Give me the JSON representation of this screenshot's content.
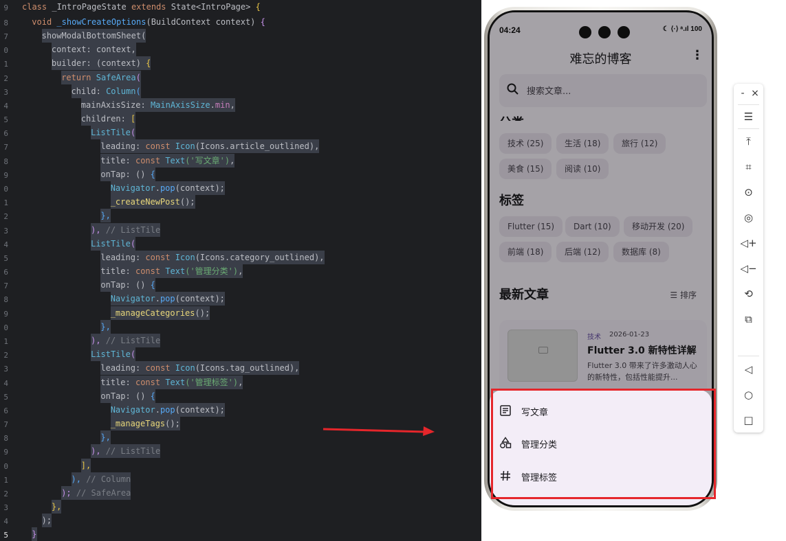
{
  "editor": {
    "line_numbers": [
      "9",
      "8",
      "7",
      "0",
      "1",
      "2",
      "3",
      "4",
      "5",
      "6",
      "7",
      "8",
      "9",
      "0",
      "1",
      "2",
      "3",
      "4",
      "5",
      "6",
      "7",
      "8",
      "9",
      "0",
      "1",
      "2",
      "3",
      "4",
      "5",
      "6",
      "7",
      "8",
      "9",
      "0",
      "1",
      "2",
      "3",
      "4",
      "5"
    ],
    "lines": [
      {
        "indent": 0,
        "tokens": [
          {
            "t": "class ",
            "c": "kw"
          },
          {
            "t": "_IntroPageState ",
            "c": "plain"
          },
          {
            "t": "extends ",
            "c": "kw"
          },
          {
            "t": "State",
            "c": "plain"
          },
          {
            "t": "<IntroPage> ",
            "c": "plain"
          },
          {
            "t": "{",
            "c": "br"
          }
        ]
      },
      {
        "indent": 1,
        "tokens": [
          {
            "t": "void ",
            "c": "kw"
          },
          {
            "t": "_showCreateOptions",
            "c": "fn"
          },
          {
            "t": "(BuildContext context) ",
            "c": "plain"
          },
          {
            "t": "{",
            "c": "br2"
          }
        ]
      },
      {
        "indent": 2,
        "tokens": [
          {
            "t": "showModalBottomSheet(",
            "c": "plain"
          }
        ]
      },
      {
        "indent": 3,
        "tokens": [
          {
            "t": "context: context,",
            "c": "plain"
          }
        ]
      },
      {
        "indent": 3,
        "tokens": [
          {
            "t": "builder: (context) ",
            "c": "plain"
          },
          {
            "t": "{",
            "c": "br"
          }
        ]
      },
      {
        "indent": 4,
        "tokens": [
          {
            "t": "return ",
            "c": "kw"
          },
          {
            "t": "SafeArea",
            "c": "cls"
          },
          {
            "t": "(",
            "c": "br2"
          }
        ]
      },
      {
        "indent": 5,
        "tokens": [
          {
            "t": "child: ",
            "c": "plain"
          },
          {
            "t": "Column",
            "c": "cls"
          },
          {
            "t": "(",
            "c": "br3"
          }
        ]
      },
      {
        "indent": 6,
        "tokens": [
          {
            "t": "mainAxisSize: ",
            "c": "plain"
          },
          {
            "t": "MainAxisSize",
            "c": "cls"
          },
          {
            "t": ".",
            "c": "plain"
          },
          {
            "t": "min",
            "c": "prop"
          },
          {
            "t": ",",
            "c": "plain"
          }
        ]
      },
      {
        "indent": 6,
        "tokens": [
          {
            "t": "children: ",
            "c": "plain"
          },
          {
            "t": "[",
            "c": "br"
          }
        ]
      },
      {
        "indent": 7,
        "tokens": [
          {
            "t": "ListTile",
            "c": "cls"
          },
          {
            "t": "(",
            "c": "br2"
          }
        ]
      },
      {
        "indent": 8,
        "tokens": [
          {
            "t": "leading: ",
            "c": "plain"
          },
          {
            "t": "const ",
            "c": "kw"
          },
          {
            "t": "Icon",
            "c": "cls"
          },
          {
            "t": "(Icons.article_outlined),",
            "c": "plain"
          }
        ]
      },
      {
        "indent": 8,
        "tokens": [
          {
            "t": "title: ",
            "c": "plain"
          },
          {
            "t": "const ",
            "c": "kw"
          },
          {
            "t": "Text",
            "c": "cls"
          },
          {
            "t": "('写文章')",
            "c": "str"
          },
          {
            "t": ",",
            "c": "plain"
          }
        ]
      },
      {
        "indent": 8,
        "tokens": [
          {
            "t": "onTap: ",
            "c": "plain"
          },
          {
            "t": "() ",
            "c": "plain"
          },
          {
            "t": "{",
            "c": "br3"
          }
        ]
      },
      {
        "indent": 9,
        "tokens": [
          {
            "t": "Navigator",
            "c": "cls"
          },
          {
            "t": ".",
            "c": "plain"
          },
          {
            "t": "pop",
            "c": "fn"
          },
          {
            "t": "(context);",
            "c": "plain"
          }
        ]
      },
      {
        "indent": 9,
        "tokens": [
          {
            "t": "_createNewPost",
            "c": "mt"
          },
          {
            "t": "();",
            "c": "plain"
          }
        ]
      },
      {
        "indent": 8,
        "tokens": [
          {
            "t": "},",
            "c": "br3"
          }
        ]
      },
      {
        "indent": 7,
        "tokens": [
          {
            "t": "), ",
            "c": "br2"
          },
          {
            "t": "// ListTile",
            "c": "cm"
          }
        ]
      },
      {
        "indent": 7,
        "tokens": [
          {
            "t": "ListTile",
            "c": "cls"
          },
          {
            "t": "(",
            "c": "br2"
          }
        ]
      },
      {
        "indent": 8,
        "tokens": [
          {
            "t": "leading: ",
            "c": "plain"
          },
          {
            "t": "const ",
            "c": "kw"
          },
          {
            "t": "Icon",
            "c": "cls"
          },
          {
            "t": "(Icons.category_outlined),",
            "c": "plain"
          }
        ]
      },
      {
        "indent": 8,
        "tokens": [
          {
            "t": "title: ",
            "c": "plain"
          },
          {
            "t": "const ",
            "c": "kw"
          },
          {
            "t": "Text",
            "c": "cls"
          },
          {
            "t": "('管理分类')",
            "c": "str"
          },
          {
            "t": ",",
            "c": "plain"
          }
        ]
      },
      {
        "indent": 8,
        "tokens": [
          {
            "t": "onTap: ",
            "c": "plain"
          },
          {
            "t": "() ",
            "c": "plain"
          },
          {
            "t": "{",
            "c": "br3"
          }
        ]
      },
      {
        "indent": 9,
        "tokens": [
          {
            "t": "Navigator",
            "c": "cls"
          },
          {
            "t": ".",
            "c": "plain"
          },
          {
            "t": "pop",
            "c": "fn"
          },
          {
            "t": "(context);",
            "c": "plain"
          }
        ]
      },
      {
        "indent": 9,
        "tokens": [
          {
            "t": "_manageCategories",
            "c": "mt"
          },
          {
            "t": "();",
            "c": "plain"
          }
        ]
      },
      {
        "indent": 8,
        "tokens": [
          {
            "t": "},",
            "c": "br3"
          }
        ]
      },
      {
        "indent": 7,
        "tokens": [
          {
            "t": "), ",
            "c": "br2"
          },
          {
            "t": "// ListTile",
            "c": "cm"
          }
        ]
      },
      {
        "indent": 7,
        "tokens": [
          {
            "t": "ListTile",
            "c": "cls"
          },
          {
            "t": "(",
            "c": "br2"
          }
        ]
      },
      {
        "indent": 8,
        "tokens": [
          {
            "t": "leading: ",
            "c": "plain"
          },
          {
            "t": "const ",
            "c": "kw"
          },
          {
            "t": "Icon",
            "c": "cls"
          },
          {
            "t": "(Icons.tag_outlined),",
            "c": "plain"
          }
        ]
      },
      {
        "indent": 8,
        "tokens": [
          {
            "t": "title: ",
            "c": "plain"
          },
          {
            "t": "const ",
            "c": "kw"
          },
          {
            "t": "Text",
            "c": "cls"
          },
          {
            "t": "('管理标签')",
            "c": "str"
          },
          {
            "t": ",",
            "c": "plain"
          }
        ]
      },
      {
        "indent": 8,
        "tokens": [
          {
            "t": "onTap: ",
            "c": "plain"
          },
          {
            "t": "() ",
            "c": "plain"
          },
          {
            "t": "{",
            "c": "br3"
          }
        ]
      },
      {
        "indent": 9,
        "tokens": [
          {
            "t": "Navigator",
            "c": "cls"
          },
          {
            "t": ".",
            "c": "plain"
          },
          {
            "t": "pop",
            "c": "fn"
          },
          {
            "t": "(context);",
            "c": "plain"
          }
        ]
      },
      {
        "indent": 9,
        "tokens": [
          {
            "t": "_manageTags",
            "c": "mt"
          },
          {
            "t": "();",
            "c": "plain"
          }
        ]
      },
      {
        "indent": 8,
        "tokens": [
          {
            "t": "},",
            "c": "br3"
          }
        ]
      },
      {
        "indent": 7,
        "tokens": [
          {
            "t": "), ",
            "c": "br2"
          },
          {
            "t": "// ListTile",
            "c": "cm"
          }
        ]
      },
      {
        "indent": 6,
        "tokens": [
          {
            "t": "],",
            "c": "br"
          }
        ]
      },
      {
        "indent": 5,
        "tokens": [
          {
            "t": "), ",
            "c": "br3"
          },
          {
            "t": "// Column",
            "c": "cm"
          }
        ]
      },
      {
        "indent": 4,
        "tokens": [
          {
            "t": "); ",
            "c": "br2"
          },
          {
            "t": "// SafeArea",
            "c": "cm"
          }
        ]
      },
      {
        "indent": 3,
        "tokens": [
          {
            "t": "},",
            "c": "br"
          }
        ]
      },
      {
        "indent": 2,
        "tokens": [
          {
            "t": ");",
            "c": "plain"
          }
        ]
      },
      {
        "indent": 1,
        "tokens": [
          {
            "t": "}",
            "c": "br2"
          }
        ]
      }
    ]
  },
  "phone": {
    "status": {
      "time": "04:24",
      "right": "☾ ⟨·⟩ ᵃ.ıl 100"
    },
    "appbar": {
      "title": "难忘的博客",
      "more": "⋮"
    },
    "search": {
      "placeholder": "搜索文章..."
    },
    "categories_title": "分类",
    "categories": [
      "技术 (25)",
      "生活 (18)",
      "旅行 (12)",
      "美食 (15)",
      "阅读 (10)"
    ],
    "tags_title": "标签",
    "tags": [
      "Flutter (15)",
      "Dart (10)",
      "移动开发 (20)",
      "前端 (18)",
      "后端 (12)",
      "数据库 (8)"
    ],
    "latest_title": "最新文章",
    "sort_label": "排序",
    "article": {
      "tag": "技术",
      "date": "2026-01-23",
      "title": "Flutter 3.0 新特性详解",
      "excerpt": "Flutter 3.0 带来了许多激动人心的新特性，包括性能提升..."
    },
    "sheet_options": [
      {
        "label": "写文章",
        "icon": "article-outlined-icon"
      },
      {
        "label": "管理分类",
        "icon": "category-outlined-icon"
      },
      {
        "label": "管理标签",
        "icon": "tag-outlined-icon"
      }
    ]
  },
  "toolbar": {
    "minimize": "-",
    "close": "×",
    "buttons": [
      "☰",
      "⤒",
      "⌗",
      "⊙",
      "◎",
      "◁+",
      "◁−",
      "⟲",
      "⧉"
    ],
    "nav": [
      "◁",
      "○",
      "□"
    ]
  },
  "colors": {
    "highlight": "#e5262b",
    "editor_bg": "#1e1f22",
    "sheet_bg": "#f3edf7"
  }
}
